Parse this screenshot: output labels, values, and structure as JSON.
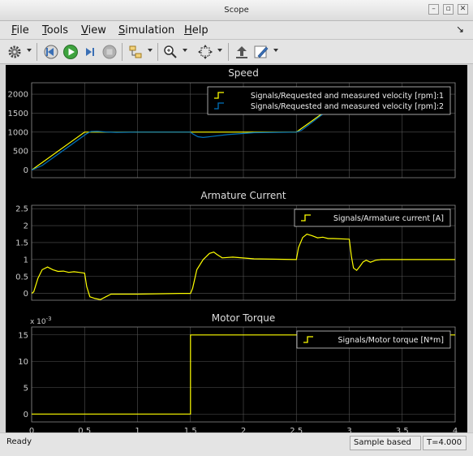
{
  "window": {
    "title": "Scope"
  },
  "menu": [
    {
      "label": "File",
      "mnemonic": "F",
      "rest": "ile"
    },
    {
      "label": "Tools",
      "mnemonic": "T",
      "rest": "ools"
    },
    {
      "label": "View",
      "mnemonic": "V",
      "rest": "iew"
    },
    {
      "label": "Simulation",
      "mnemonic": "S",
      "rest": "imulation"
    },
    {
      "label": "Help",
      "mnemonic": "H",
      "rest": "elp"
    }
  ],
  "toolbar": {
    "icons": [
      "settings-icon",
      "step-back-icon",
      "run-icon",
      "step-forward-icon",
      "stop-icon",
      "signal-selector-icon",
      "zoom-icon",
      "autoscale-icon",
      "highlight-block-icon",
      "style-icon"
    ]
  },
  "status": {
    "ready": "Ready",
    "mode": "Sample based",
    "time": "T=4.000"
  },
  "colors": {
    "yellow": "#ffff00",
    "blue": "#0072bd",
    "axes_bg": "#000000",
    "grid": "#555555",
    "tick_text": "#cccccc"
  },
  "chart_data": [
    {
      "type": "line",
      "title": "Speed",
      "xlim": [
        0,
        4
      ],
      "ylim": [
        -200,
        2300
      ],
      "yticks": [
        0,
        500,
        1000,
        1500,
        2000
      ],
      "xticks": [
        0,
        0.5,
        1,
        1.5,
        2,
        2.5,
        3,
        3.5,
        4
      ],
      "show_xtick_labels": false,
      "grid": true,
      "legend_position": "top-right",
      "series": [
        {
          "name": "Signals/Requested and measured velocity [rpm]:1",
          "color": "#ffff00",
          "x": [
            0,
            0.5,
            0.7,
            1.5,
            2.5,
            2.8
          ],
          "y": [
            0,
            1000,
            1000,
            1000,
            1000,
            1600
          ]
        },
        {
          "name": "Signals/Requested and measured velocity [rpm]:2",
          "color": "#0072bd",
          "x": [
            0,
            0.1,
            0.52,
            0.56,
            0.62,
            0.7,
            0.8,
            1.0,
            1.5,
            1.52,
            1.57,
            1.62,
            1.7,
            1.85,
            2.1,
            2.5,
            2.55,
            2.8
          ],
          "y": [
            0,
            120,
            960,
            1015,
            1020,
            1005,
            995,
            1000,
            1000,
            955,
            880,
            860,
            885,
            935,
            985,
            1000,
            1050,
            1580
          ]
        }
      ]
    },
    {
      "type": "line",
      "title": "Armature Current",
      "xlim": [
        0,
        4
      ],
      "ylim": [
        -0.2,
        2.6
      ],
      "yticks": [
        0,
        0.5,
        1,
        1.5,
        2,
        2.5
      ],
      "xticks": [
        0,
        0.5,
        1,
        1.5,
        2,
        2.5,
        3,
        3.5,
        4
      ],
      "show_xtick_labels": false,
      "grid": true,
      "legend_position": "top-right",
      "series": [
        {
          "name": "Signals/Armature current [A]",
          "color": "#ffff00",
          "x": [
            0,
            0.02,
            0.06,
            0.1,
            0.15,
            0.2,
            0.25,
            0.3,
            0.35,
            0.4,
            0.45,
            0.5,
            0.52,
            0.55,
            0.6,
            0.65,
            0.7,
            0.75,
            0.8,
            1.0,
            1.4,
            1.5,
            1.52,
            1.56,
            1.62,
            1.68,
            1.72,
            1.75,
            1.8,
            1.9,
            2.1,
            2.5,
            2.52,
            2.56,
            2.6,
            2.65,
            2.7,
            2.75,
            2.8,
            2.85,
            3.0,
            3.02,
            3.04,
            3.07,
            3.1,
            3.13,
            3.16,
            3.2,
            3.25,
            3.3,
            3.5,
            4.0
          ],
          "y": [
            0,
            0.05,
            0.45,
            0.7,
            0.78,
            0.7,
            0.65,
            0.66,
            0.62,
            0.64,
            0.62,
            0.6,
            0.2,
            -0.1,
            -0.15,
            -0.18,
            -0.1,
            -0.02,
            -0.02,
            -0.02,
            0,
            0,
            0.15,
            0.7,
            1.0,
            1.18,
            1.22,
            1.15,
            1.05,
            1.07,
            1.02,
            1.0,
            1.35,
            1.65,
            1.75,
            1.7,
            1.64,
            1.66,
            1.62,
            1.62,
            1.6,
            1.1,
            0.75,
            0.68,
            0.8,
            0.93,
            0.98,
            0.92,
            0.98,
            1.0,
            1.0,
            1.0
          ]
        }
      ]
    },
    {
      "type": "line",
      "title": "Motor Torque",
      "xlim": [
        0,
        4
      ],
      "ylim": [
        -0.0015,
        0.0165
      ],
      "yticks": [
        0,
        0.005,
        0.01,
        0.015
      ],
      "ytick_labels": [
        "0",
        "5",
        "10",
        "15"
      ],
      "y_exponent_label": "x 10-3",
      "xticks": [
        0,
        0.5,
        1,
        1.5,
        2,
        2.5,
        3,
        3.5,
        4
      ],
      "xtick_labels": [
        "0",
        "0.5",
        "1",
        "1.5",
        "2",
        "2.5",
        "3",
        "3.5",
        "4"
      ],
      "show_xtick_labels": true,
      "grid": true,
      "legend_position": "top-right",
      "series": [
        {
          "name": "Signals/Motor torque [N*m]",
          "color": "#ffff00",
          "x": [
            0,
            1.5,
            1.5,
            4
          ],
          "y": [
            0,
            0,
            0.015,
            0.015
          ]
        }
      ]
    }
  ]
}
